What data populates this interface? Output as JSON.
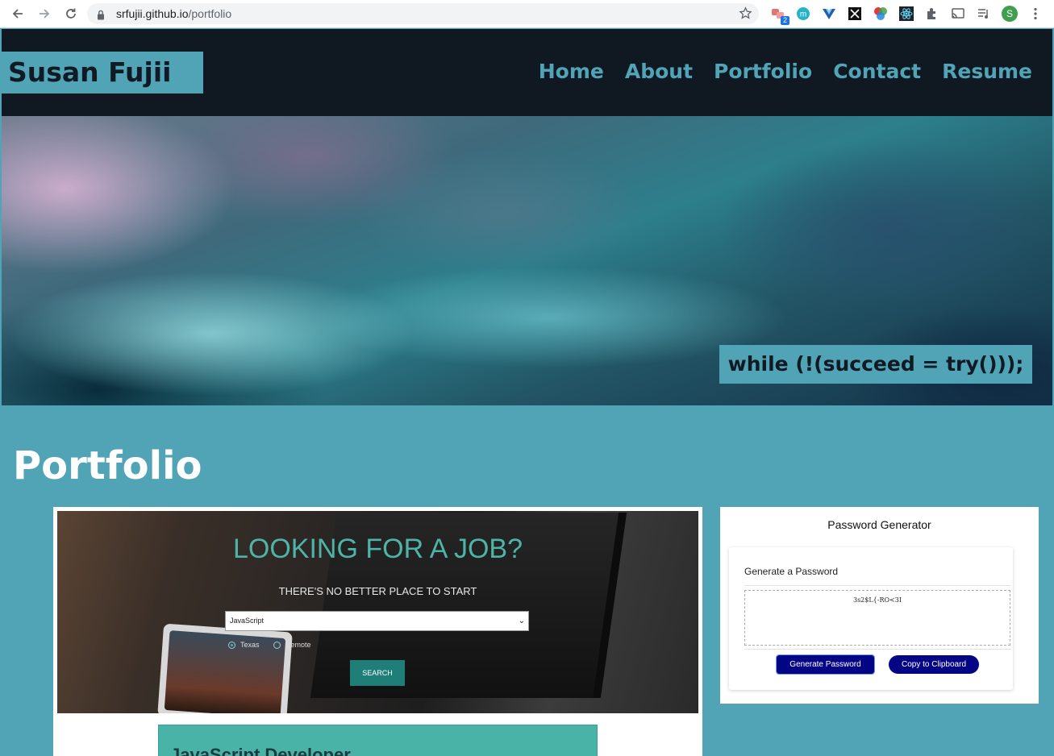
{
  "browser": {
    "url_host": "srfujii.github.io",
    "url_path": "/portfolio",
    "extension_badge": "2",
    "profile_initial": "S"
  },
  "site": {
    "brand": "Susan Fujii",
    "nav": [
      "Home",
      "About",
      "Portfolio",
      "Contact",
      "Resume"
    ],
    "motto": "while (!(succeed = try()));"
  },
  "portfolio": {
    "title": "Portfolio",
    "job_card": {
      "heading": "LOOKING FOR A JOB?",
      "subheading": "THERE'S NO BETTER PLACE TO START",
      "select_value": "JavaScript",
      "radio_options": [
        "Texas",
        "Remote"
      ],
      "radio_selected": "Texas",
      "search_label": "SEARCH",
      "banner_text": "JavaScript Developer"
    },
    "password_card": {
      "title": "Password Generator",
      "panel_title": "Generate a Password",
      "generated_password": "3s2$L{-RO<3I",
      "generate_label": "Generate Password",
      "copy_label": "Copy to Clipboard"
    }
  },
  "colors": {
    "accent": "#51a4b6",
    "header_bg": "#101922",
    "button_navy": "#040585",
    "job_teal": "#4fb3a6"
  }
}
